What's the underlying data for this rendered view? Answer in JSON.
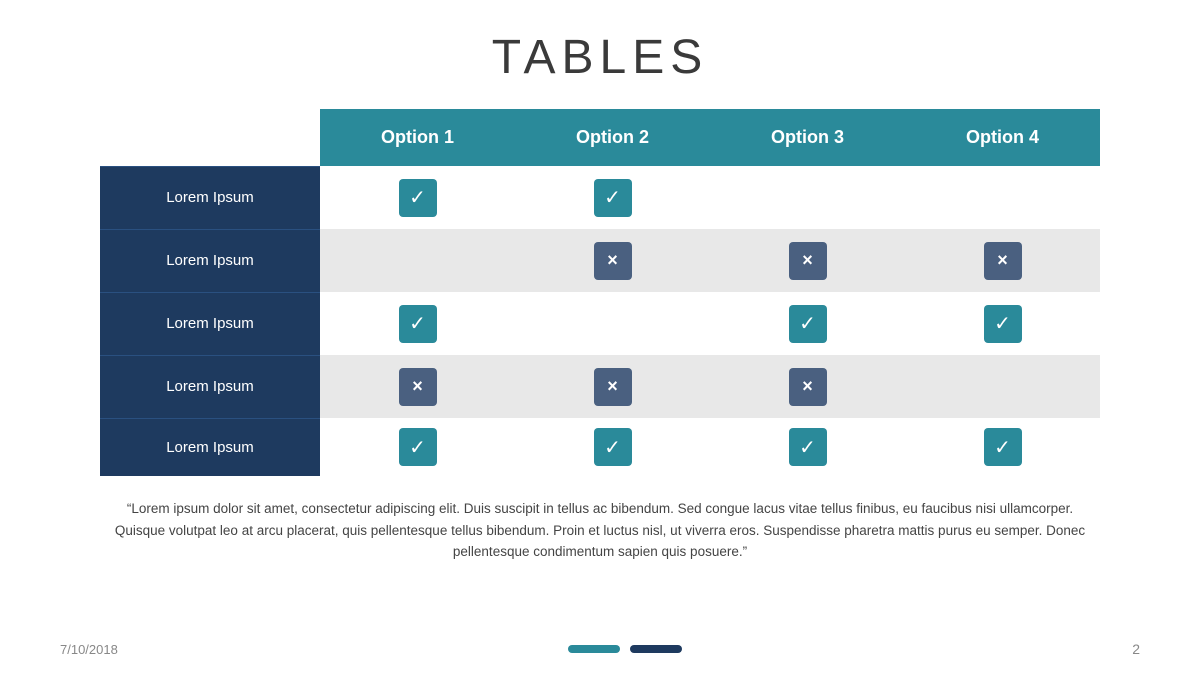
{
  "title": "TABLES",
  "table": {
    "headers": [
      "",
      "Option 1",
      "Option 2",
      "Option 3",
      "Option 4"
    ],
    "rows": [
      {
        "label": "Lorem Ipsum",
        "cells": [
          "check",
          "check",
          "empty",
          "empty"
        ]
      },
      {
        "label": "Lorem Ipsum",
        "cells": [
          "empty",
          "cross",
          "cross",
          "cross"
        ]
      },
      {
        "label": "Lorem Ipsum",
        "cells": [
          "check",
          "empty",
          "check",
          "check"
        ]
      },
      {
        "label": "Lorem Ipsum",
        "cells": [
          "cross",
          "cross",
          "cross",
          "empty"
        ]
      },
      {
        "label": "Lorem Ipsum",
        "cells": [
          "check",
          "check",
          "check",
          "check"
        ]
      }
    ]
  },
  "quote": "“Lorem ipsum dolor sit amet, consectetur adipiscing elit. Duis suscipit in tellus ac bibendum. Sed congue lacus vitae tellus finibus, eu faucibus nisi ullamcorper. Quisque volutpat leo at arcu placerat,  quis pellentesque tellus bibendum. Proin et luctus nisl, ut viverra eros. Suspendisse pharetra mattis purus eu semper. Donec pellentesque condimentum sapien quis posuere.”",
  "footer": {
    "date": "7/10/2018",
    "page": "2"
  },
  "icons": {
    "check": "✓",
    "cross": "×"
  }
}
